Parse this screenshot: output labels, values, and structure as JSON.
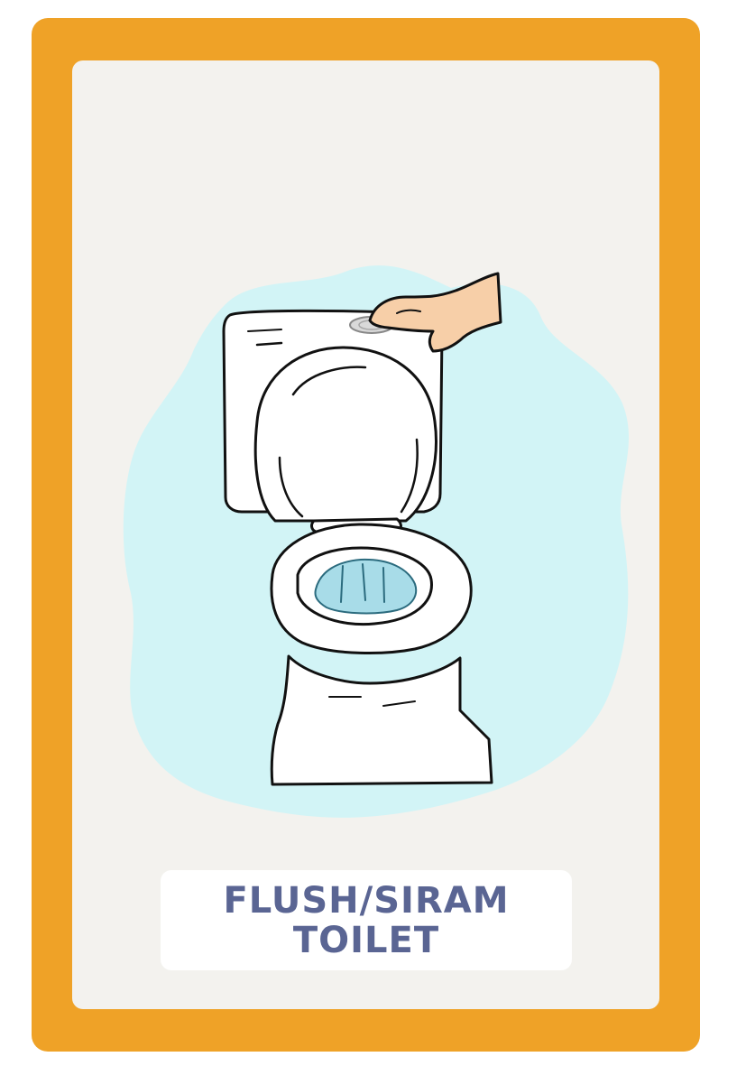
{
  "card": {
    "frame_color": "#EFA227",
    "background_color": "#F3F2EE",
    "accent_color": "#5A6593"
  },
  "illustration": {
    "subject": "toilet-flush",
    "icons": [
      "toilet-icon",
      "hand-icon",
      "flush-button-icon",
      "water-splash-icon"
    ],
    "colors": {
      "blob": "#D2F4F6",
      "water": "#A8DCE8",
      "skin": "#F7CFA8",
      "outline": "#111111"
    }
  },
  "caption": {
    "line1": "FLUSH/SIRAM",
    "line2": "TOILET"
  }
}
